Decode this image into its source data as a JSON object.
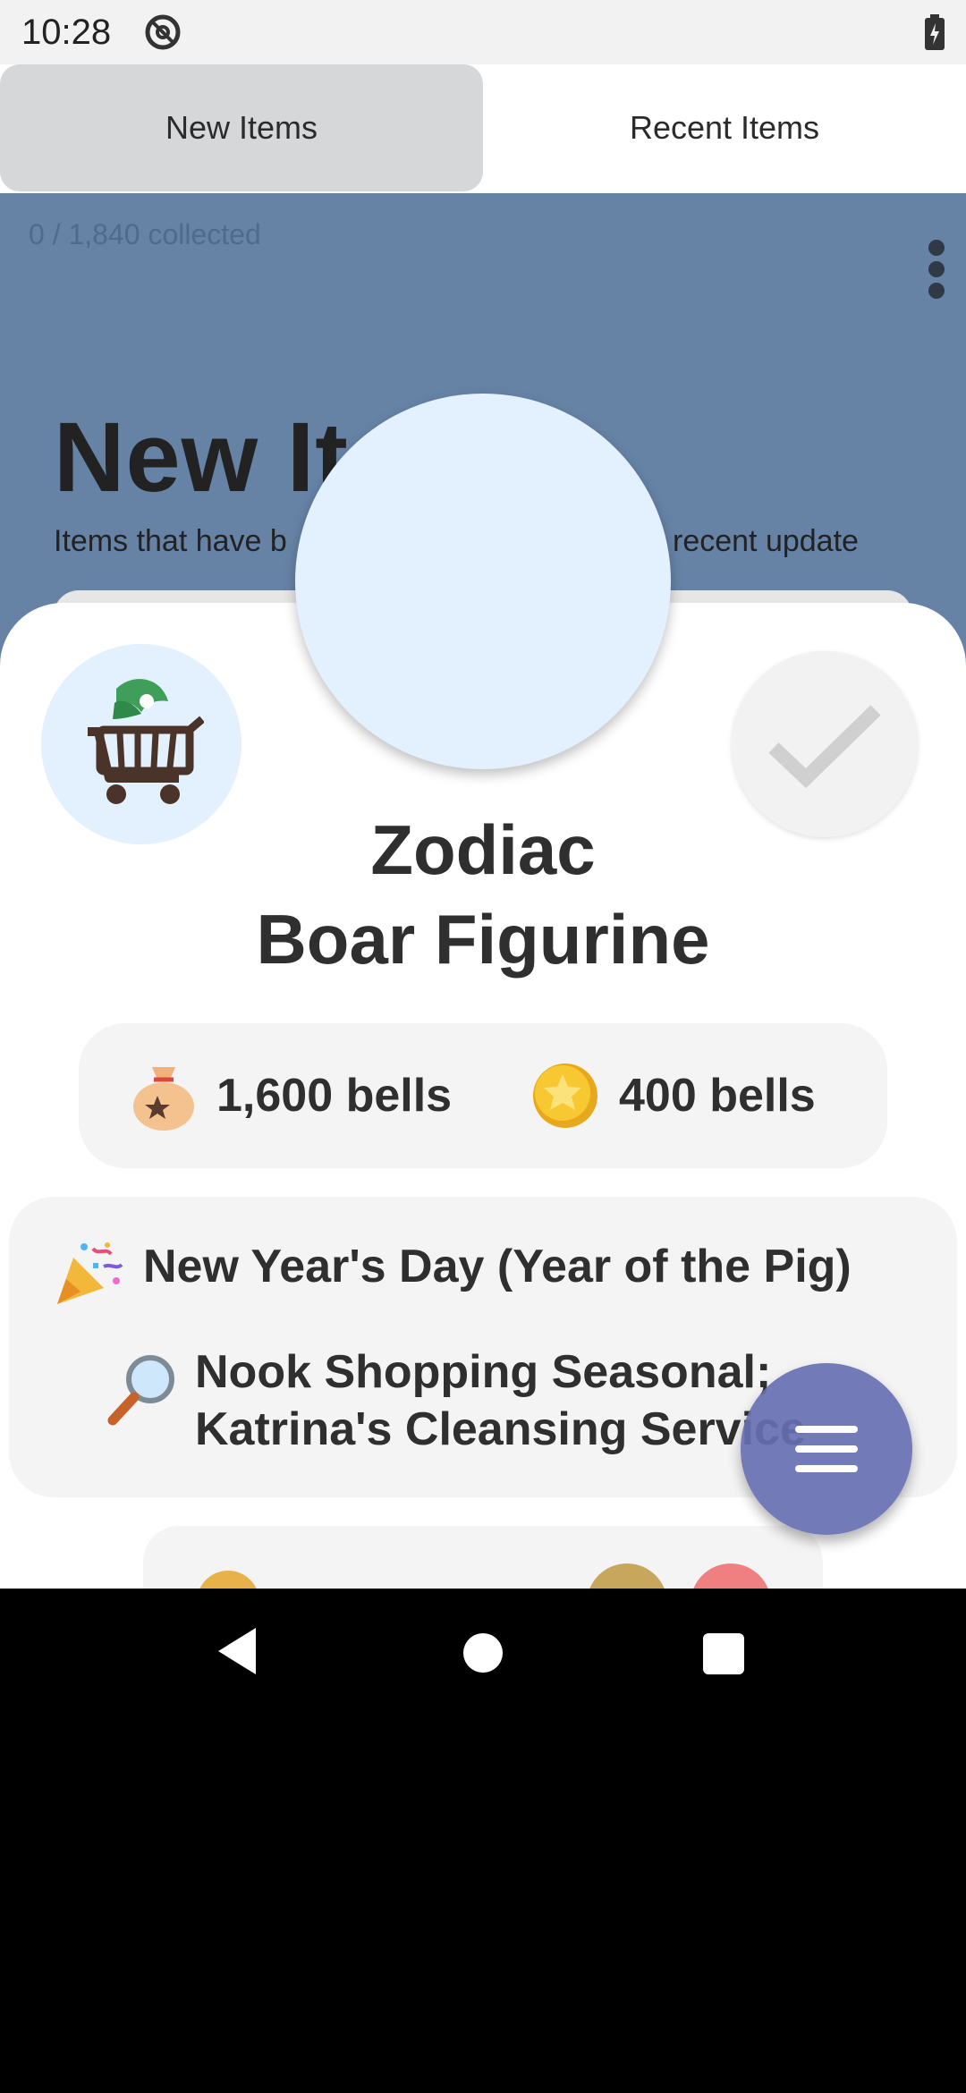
{
  "status_bar": {
    "time": "10:28"
  },
  "tabs": [
    {
      "label": "New Items",
      "selected": true
    },
    {
      "label": "Recent Items",
      "selected": false
    }
  ],
  "background": {
    "collected": "0 / 1,840 collected",
    "title_visible": "New It",
    "subtitle_left": "Items that have b",
    "subtitle_right": "recent update"
  },
  "item": {
    "name_line1": "Zodiac",
    "name_line2": "Boar Figurine",
    "buy_price": "1,600 bells",
    "sell_price": "400 bells",
    "event": "New Year's Day (Year of the Pig)",
    "source_line1": "Nook Shopping Seasonal;",
    "source_line2": "Katrina's Cleansing Service"
  },
  "icons": {
    "cart": "shopping-cart-icon",
    "check": "check-icon",
    "bell_bag": "bell-bag-icon",
    "coin": "coin-icon",
    "party": "party-popper-icon",
    "magnifier": "magnifier-icon",
    "menu": "menu-icon"
  },
  "colors": {
    "background_blue": "#6683a6",
    "fab": "#6670b2",
    "circle_light_blue": "#e3f0fd"
  }
}
